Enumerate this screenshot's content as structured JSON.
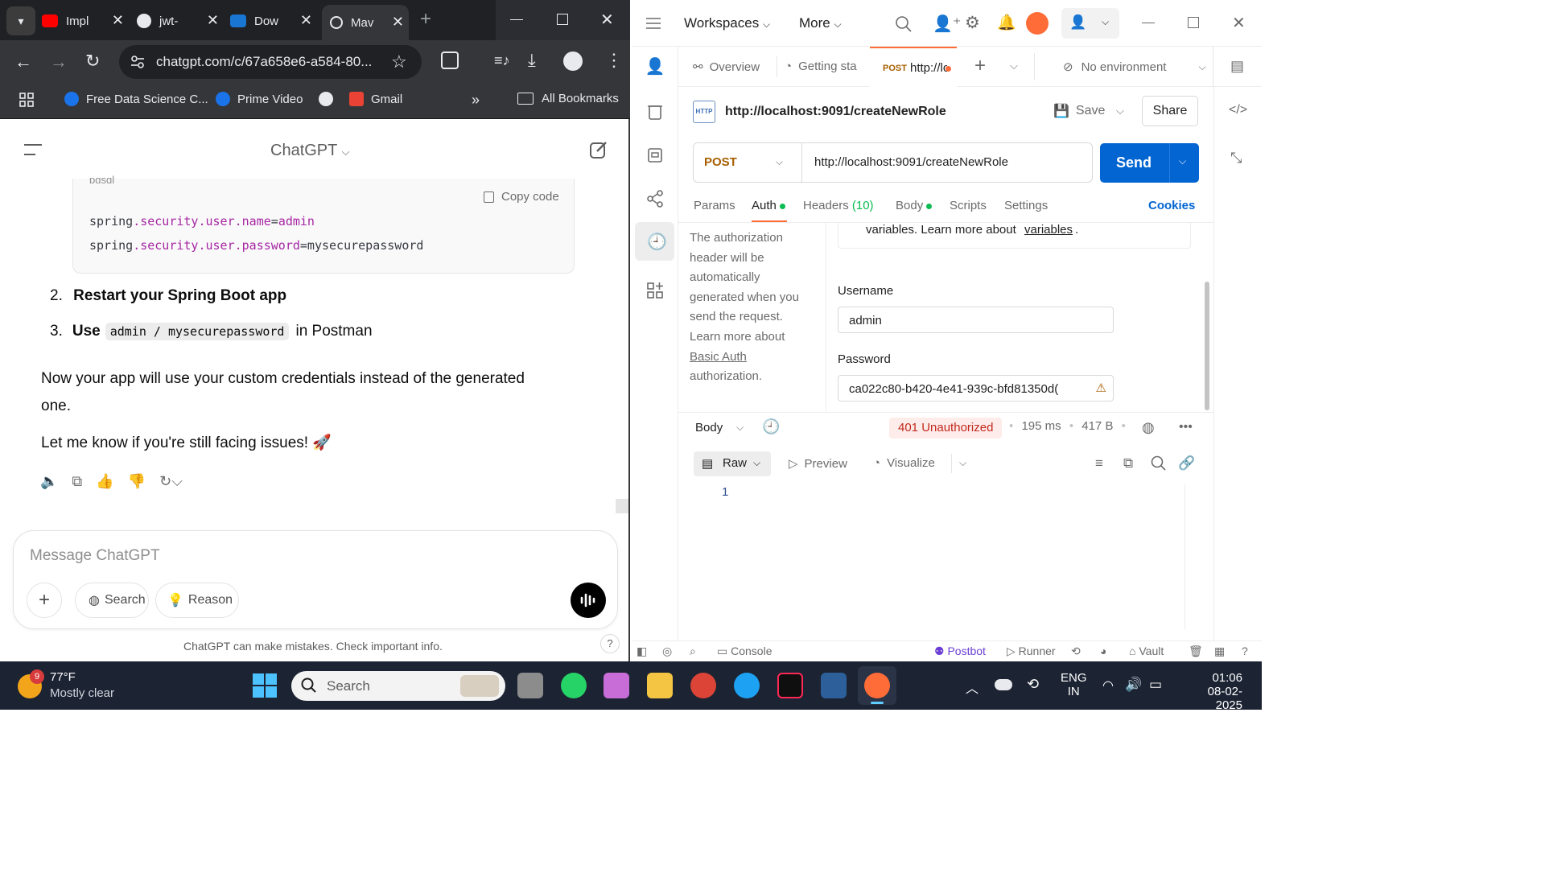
{
  "chrome": {
    "tabs": [
      {
        "title": "Impl",
        "color": "#ff0000",
        "icon": "youtube-icon"
      },
      {
        "title": "jwt-",
        "color": "#ffffff",
        "icon": "github-icon"
      },
      {
        "title": "Dow",
        "color": "#1976d2",
        "icon": "maven-icon"
      },
      {
        "title": "Mav",
        "color": "#ffffff",
        "icon": "chatgpt-icon"
      }
    ],
    "url": "chatgpt.com/c/67a658e6-a584-80...",
    "bookmarks": {
      "item1": "Free Data Science C...",
      "item2": "Prime Video",
      "item3": "Gmail",
      "all": "All Bookmarks"
    }
  },
  "chatgpt": {
    "title": "ChatGPT",
    "code_lang": "pgsql",
    "copy_code": "Copy code",
    "code_line1": {
      "a": "spring",
      "b": ".security",
      "c": ".user",
      "d": ".name",
      "e": "=",
      "f": "admin"
    },
    "code_line2": {
      "a": "spring",
      "b": ".security",
      "c": ".user",
      "d": ".password",
      "e": "=mysecurepassword"
    },
    "step2_num": "2.",
    "step2": "Restart your Spring Boot app",
    "step3_num": "3.",
    "step3_bold": "Use",
    "step3_code": "admin / mysecurepassword",
    "step3_tail": "in Postman",
    "para1_line1": "Now your app will use your custom credentials instead of the generated",
    "para1_line2": "one.",
    "para2": "Let me know if you're still facing issues! 🚀",
    "composer_placeholder": "Message ChatGPT",
    "search_label": "Search",
    "reason_label": "Reason",
    "disclaimer": "ChatGPT can make mistakes. Check important info.",
    "help": "?"
  },
  "postman": {
    "workspaces": "Workspaces",
    "more": "More",
    "tabs": {
      "overview": "Overview",
      "getting_started": "Getting sta",
      "active_method": "POST",
      "active_url": "http://lo",
      "no_env": "No environment"
    },
    "request_title": "http://localhost:9091/createNewRole",
    "save": "Save",
    "share": "Share",
    "method": "POST",
    "url": "http://localhost:9091/createNewRole",
    "send": "Send",
    "req_tabs": {
      "params": "Params",
      "auth": "Auth",
      "headers": "Headers",
      "headers_count": "(10)",
      "body": "Body",
      "scripts": "Scripts",
      "settings": "Settings",
      "cookies": "Cookies"
    },
    "auth_help": {
      "l1": "The authorization",
      "l2": "header will be",
      "l3": "automatically",
      "l4": "generated when you",
      "l5": "send the request.",
      "l6": "Learn more about",
      "link": "Basic Auth",
      "l8": "authorization."
    },
    "vars_note": "variables. Learn more about",
    "vars_link": "variables",
    "username_label": "Username",
    "username_value": "admin",
    "password_label": "Password",
    "password_value": "ca022c80-b420-4e41-939c-bfd81350d(",
    "response": {
      "body_label": "Body",
      "status": "401 Unauthorized",
      "time": "195 ms",
      "size": "417 B",
      "raw": "Raw",
      "preview": "Preview",
      "visualize": "Visualize",
      "line_no": "1"
    },
    "statusbar": {
      "console": "Console",
      "postbot": "Postbot",
      "runner": "Runner",
      "vault": "Vault"
    }
  },
  "taskbar": {
    "weather_badge": "9",
    "temp": "77°F",
    "condition": "Mostly clear",
    "search": "Search",
    "lang1": "ENG",
    "lang2": "IN",
    "time": "01:06",
    "date": "08-02-2025"
  },
  "colors": {
    "accent_blue": "#0265d2",
    "postman_orange": "#ff6c37",
    "status_red": "#c4281c",
    "status_bg": "#fdecea"
  }
}
